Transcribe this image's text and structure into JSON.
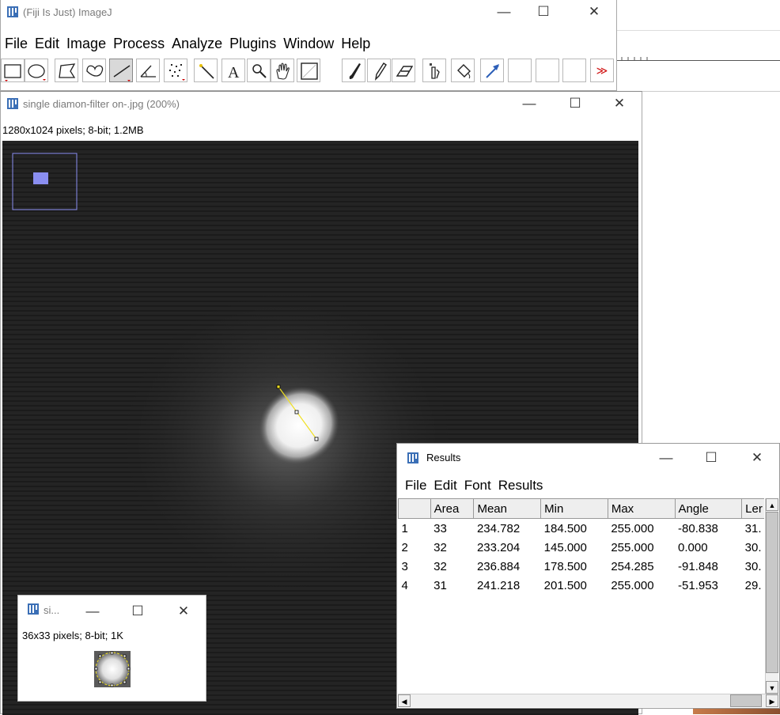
{
  "imagej": {
    "title": "(Fiji Is Just) ImageJ",
    "menu": [
      "File",
      "Edit",
      "Image",
      "Process",
      "Analyze",
      "Plugins",
      "Window",
      "Help"
    ],
    "tools": [
      "rectangle-tool",
      "oval-tool",
      "polygon-tool",
      "freehand-tool",
      "line-tool",
      "angle-tool",
      "multipoint-tool",
      "wand-tool",
      "text-tool",
      "magnifier-tool",
      "hand-tool",
      "color-picker-tool",
      "brush-tool",
      "pencil-tool",
      "eraser-tool",
      "flood-fill-tool",
      "bucket-tool",
      "arrow-tool"
    ],
    "more_tools": "≫"
  },
  "image_window": {
    "title": "single diamon-filter on-.jpg (200%)",
    "info": "1280x1024 pixels; 8-bit; 1.2MB"
  },
  "small_window": {
    "title": "si...",
    "info": "36x33 pixels; 8-bit; 1K"
  },
  "results": {
    "title": "Results",
    "menu": [
      "File",
      "Edit",
      "Font",
      "Results"
    ],
    "columns": [
      "",
      "Area",
      "Mean",
      "Min",
      "Max",
      "Angle",
      "Ler"
    ],
    "rows": [
      [
        "1",
        "33",
        "234.782",
        "184.500",
        "255.000",
        "-80.838",
        "31."
      ],
      [
        "2",
        "32",
        "233.204",
        "145.000",
        "255.000",
        "0.000",
        "30."
      ],
      [
        "3",
        "32",
        "236.884",
        "178.500",
        "254.285",
        "-91.848",
        "30."
      ],
      [
        "4",
        "31",
        "241.218",
        "201.500",
        "255.000",
        "-51.953",
        "29."
      ]
    ]
  },
  "window_controls": {
    "minimize": "—",
    "maximize": "☐",
    "close": "✕"
  }
}
